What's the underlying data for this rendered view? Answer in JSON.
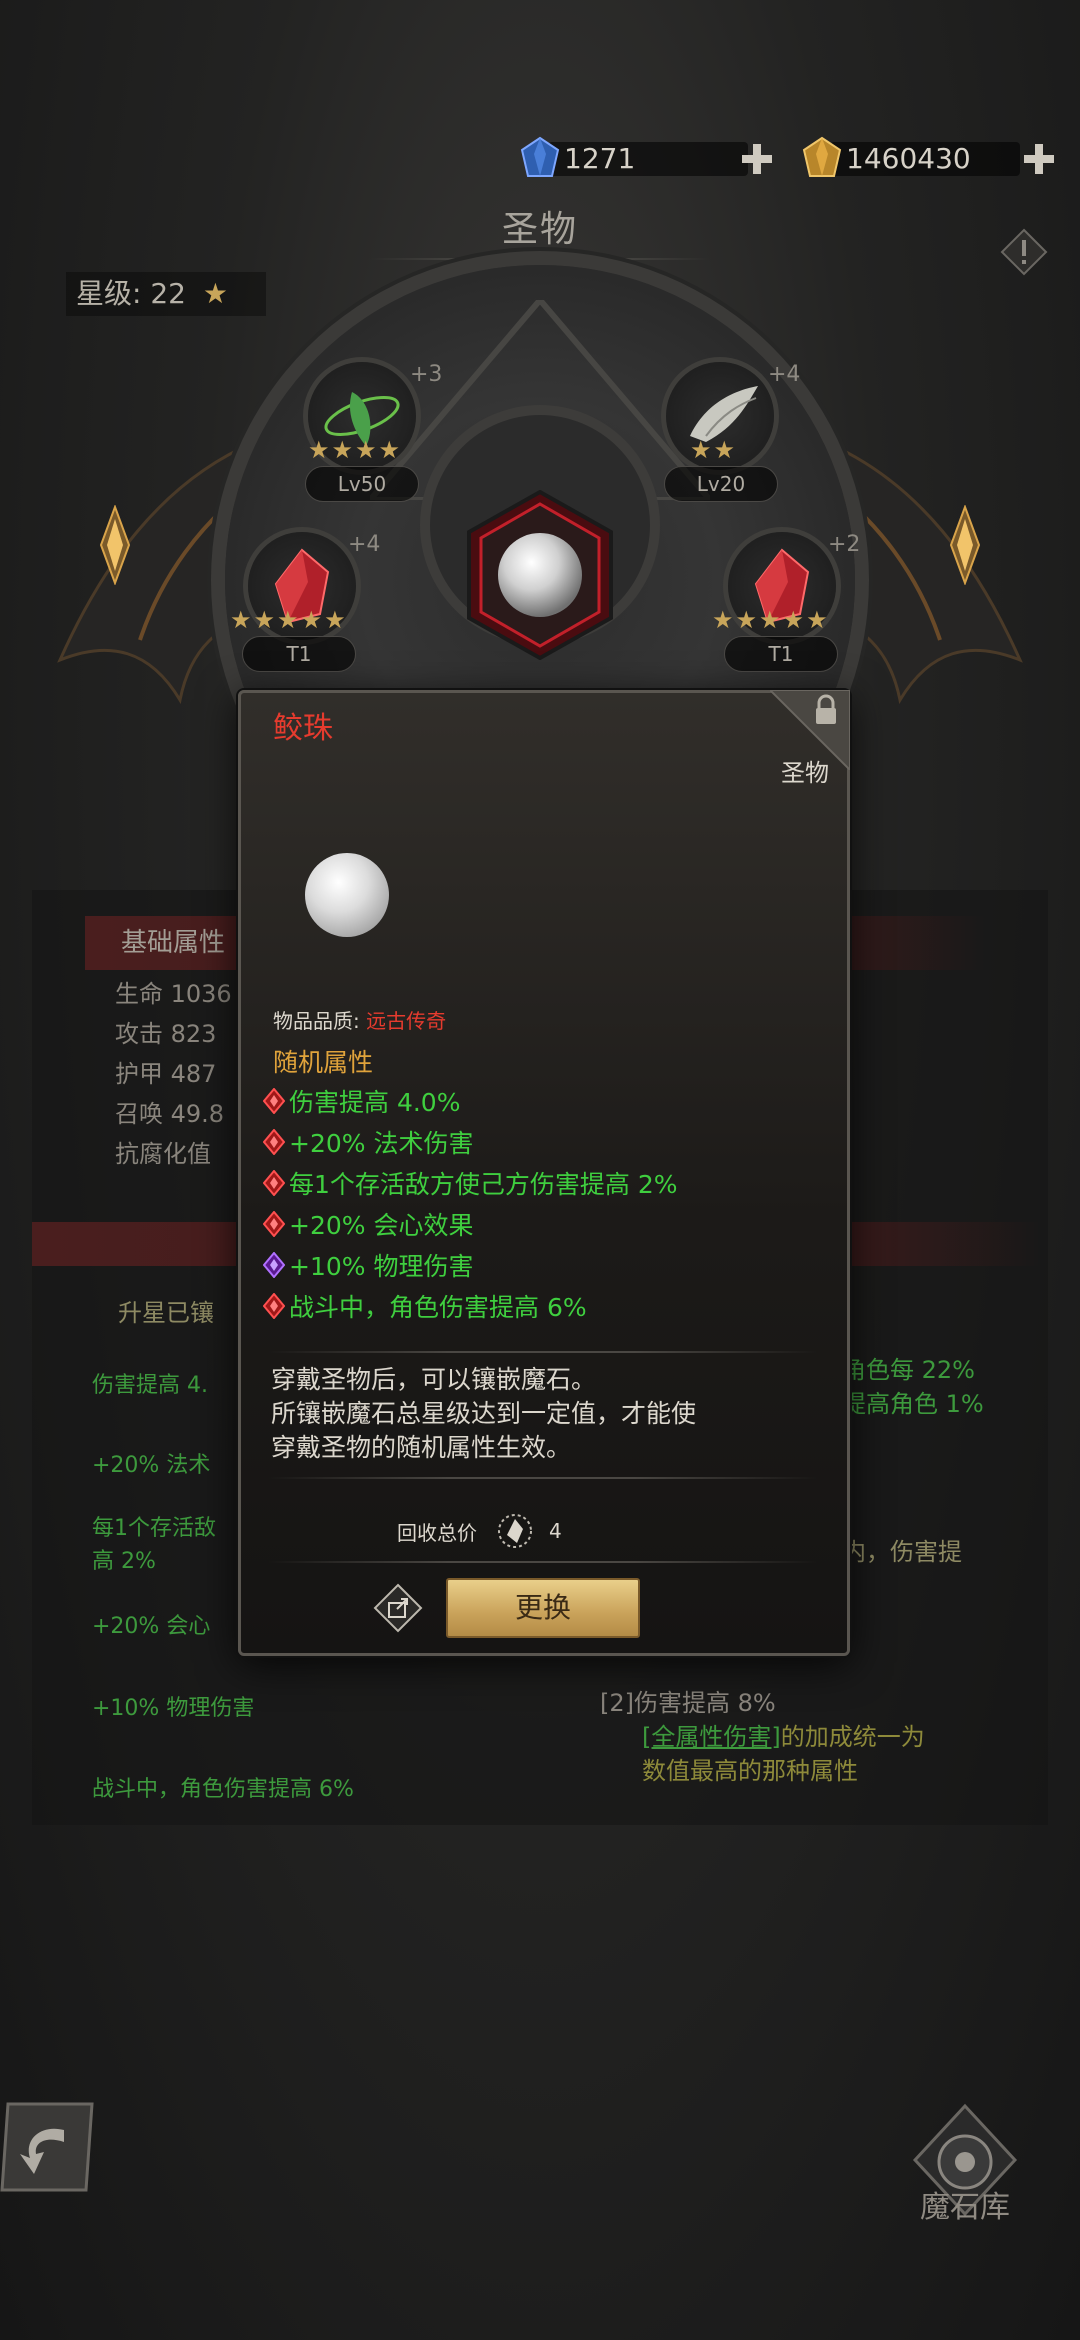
{
  "currency": {
    "gems": "1271",
    "gold": "1460430"
  },
  "header": {
    "title": "圣物"
  },
  "star_level": {
    "label": "星级:",
    "value": "22"
  },
  "slots": [
    {
      "plus": "+3",
      "level": "Lv50",
      "stars": "★★★★"
    },
    {
      "plus": "+4",
      "level": "Lv20",
      "stars": "★★"
    },
    {
      "plus": "+4",
      "level": "T1",
      "stars": "★★★★★"
    },
    {
      "plus": "+2",
      "level": "T1",
      "stars": "★★★★★"
    }
  ],
  "background": {
    "base_header": "基础属性",
    "stats": [
      "生命 1036",
      "攻击 823",
      "护甲 487",
      "召唤 49.8",
      "抗腐化值"
    ],
    "upgrade_label": "升星已镶",
    "left_attrs": [
      "伤害提高 4.",
      "+20% 法术",
      "每1个存活敌",
      "高 2%",
      "+20% 会心",
      "+10% 物理伤害",
      "战斗中，角色伤害提高 6%"
    ],
    "right_frag1": ")",
    "right_frag2": "角色每 22%",
    "right_frag3": "提高角色 1%",
    "right_frag4": ")",
    "right_frag5": "内，伤害提",
    "right_set": "[2]伤害提高 8%",
    "right_link": "[全属性伤害]",
    "right_link_tail": "的加成统一为",
    "right_link_line2": "数值最高的那种属性"
  },
  "popup": {
    "name": "鲛珠",
    "type": "圣物",
    "quality_label": "物品品质:",
    "quality_value": "远古传奇",
    "random_title": "随机属性",
    "attributes": [
      {
        "text": "伤害提高 4.0%",
        "gem": "red"
      },
      {
        "text": "+20% 法术伤害",
        "gem": "red"
      },
      {
        "text": "每1个存活敌方使己方伤害提高 2%",
        "gem": "red"
      },
      {
        "text": "+20% 会心效果",
        "gem": "red"
      },
      {
        "text": "+10% 物理伤害",
        "gem": "purple"
      },
      {
        "text": "战斗中，角色伤害提高 6%",
        "gem": "red"
      }
    ],
    "desc_line1": "穿戴圣物后，可以镶嵌魔石。",
    "desc_line2": "所镶嵌魔石总星级达到一定值，才能使",
    "desc_line3": "穿戴圣物的随机属性生效。",
    "recycle_label": "回收总价",
    "recycle_value": "4",
    "change_button": "更换"
  },
  "footer": {
    "warehouse_label": "魔石库"
  },
  "colors": {
    "legendary": "#e63b2e",
    "attr_green": "#3fcf3f",
    "gold": "#e0a33b"
  }
}
